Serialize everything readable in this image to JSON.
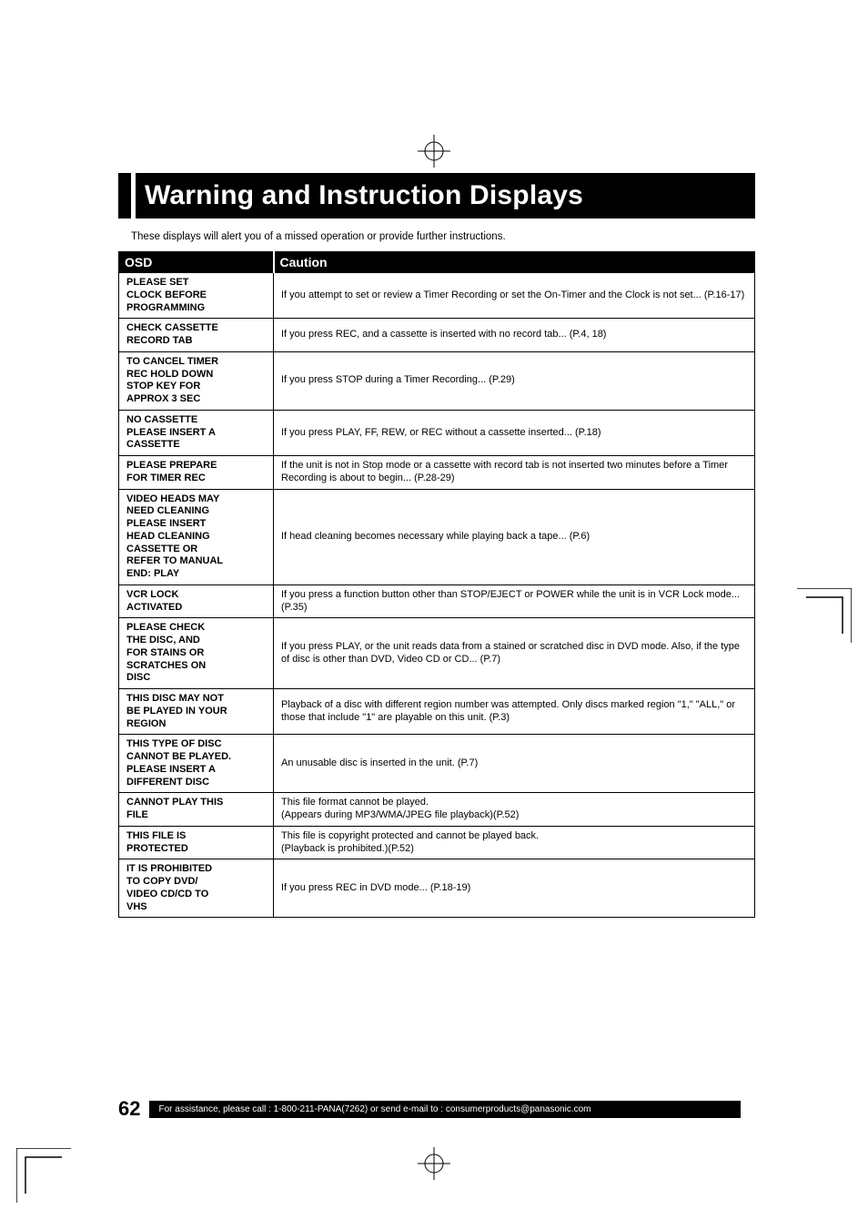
{
  "title": "Warning and Instruction Displays",
  "intro": "These displays will alert you of a missed operation or provide further instructions.",
  "table": {
    "headers": {
      "osd": "OSD",
      "caution": "Caution"
    },
    "rows": [
      {
        "osd": "PLEASE SET\nCLOCK BEFORE\nPROGRAMMING",
        "caution": "If you attempt to set or review a Timer Recording or set the On-Timer and the Clock is not set... (P.16-17)"
      },
      {
        "osd": "CHECK CASSETTE\nRECORD TAB",
        "caution": "If you press REC, and a cassette is inserted with no record tab... (P.4, 18)"
      },
      {
        "osd": "TO CANCEL TIMER\nREC HOLD DOWN\nSTOP KEY FOR\nAPPROX 3 SEC",
        "caution": "If you press STOP during a Timer Recording... (P.29)"
      },
      {
        "osd": "NO CASSETTE\nPLEASE INSERT A\nCASSETTE",
        "caution": "If you press PLAY, FF, REW, or REC without a cassette inserted... (P.18)"
      },
      {
        "osd": "PLEASE PREPARE\nFOR TIMER REC",
        "caution": "If the unit is not in Stop mode or a cassette with record tab is not inserted two minutes before a Timer Recording is about to begin... (P.28-29)"
      },
      {
        "osd": "VIDEO HEADS MAY\nNEED CLEANING\nPLEASE INSERT\nHEAD CLEANING\nCASSETTE OR\nREFER TO MANUAL\nEND: PLAY",
        "caution": "If head cleaning becomes necessary while playing back a tape... (P.6)"
      },
      {
        "osd": "VCR LOCK\nACTIVATED",
        "caution": "If you press a function button other than STOP/EJECT or POWER while the unit is in VCR Lock mode... (P.35)"
      },
      {
        "osd": "PLEASE CHECK\nTHE DISC, AND\nFOR STAINS OR\nSCRATCHES ON\nDISC",
        "caution": "If you press PLAY, or the unit reads data from a stained or scratched disc in DVD mode. Also, if the type of disc is other than DVD, Video CD or CD... (P.7)"
      },
      {
        "osd": "THIS DISC MAY NOT\nBE PLAYED IN YOUR\nREGION",
        "caution": "Playback of a disc with different region number was attempted. Only discs marked region \"1,\" \"ALL,\" or those that include \"1\" are playable on this unit. (P.3)"
      },
      {
        "osd": "THIS TYPE OF DISC\nCANNOT BE PLAYED.\nPLEASE INSERT A\nDIFFERENT DISC",
        "caution": "An unusable disc is inserted in the unit. (P.7)"
      },
      {
        "osd": "CANNOT PLAY THIS\nFILE",
        "caution": "This file format cannot be played.\n(Appears during MP3/WMA/JPEG file playback)(P.52)"
      },
      {
        "osd": "THIS FILE IS\nPROTECTED",
        "caution": "This file is copyright protected and cannot be played back.\n(Playback is prohibited.)(P.52)"
      },
      {
        "osd": "IT IS PROHIBITED\nTO COPY DVD/\nVIDEO CD/CD TO\nVHS",
        "caution": "If you press REC in DVD mode... (P.18-19)"
      }
    ]
  },
  "footer": {
    "page_number": "62",
    "assist_text": "For assistance, please call : 1-800-211-PANA(7262) or send e-mail to : consumerproducts@panasonic.com"
  }
}
